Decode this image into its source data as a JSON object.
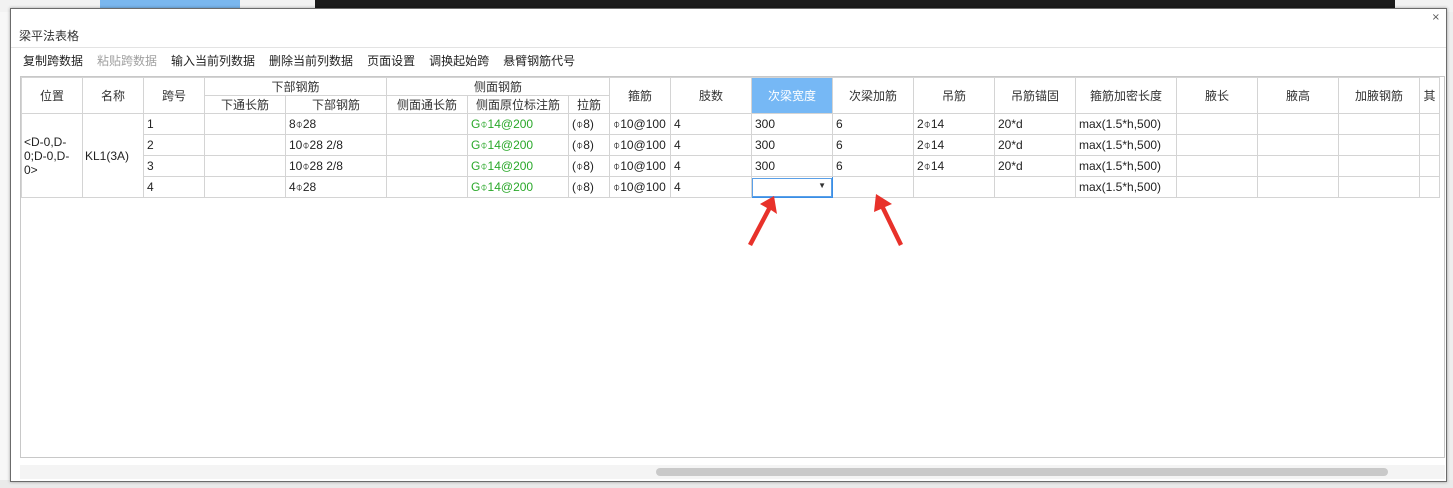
{
  "dialog": {
    "title": "梁平法表格",
    "close_label": "×"
  },
  "toolbar": [
    {
      "label": "复制跨数据",
      "enabled": true
    },
    {
      "label": "粘贴跨数据",
      "enabled": false
    },
    {
      "label": "输入当前列数据",
      "enabled": true
    },
    {
      "label": "删除当前列数据",
      "enabled": true
    },
    {
      "label": "页面设置",
      "enabled": true
    },
    {
      "label": "调换起始跨",
      "enabled": true
    },
    {
      "label": "悬臂钢筋代号",
      "enabled": true
    }
  ],
  "table": {
    "group_headers": {
      "bottom_rebar": "下部钢筋",
      "side_rebar": "侧面钢筋"
    },
    "headers": {
      "position": "位置",
      "name": "名称",
      "span": "跨号",
      "bottom_through": "下通长筋",
      "bottom_steel": "下部钢筋",
      "side_through": "侧面通长筋",
      "side_original": "侧面原位标注筋",
      "tie": "拉筋",
      "stirrup": "箍筋",
      "legs": "肢数",
      "sec_beam_width": "次梁宽度",
      "sec_beam_add": "次梁加筋",
      "hanger": "吊筋",
      "hanger_anchor": "吊筋锚固",
      "stirrup_dense": "箍筋加密长度",
      "haunch_len": "腋长",
      "haunch_height": "腋高",
      "haunch_steel": "加腋钢筋",
      "other": "其"
    },
    "merged": {
      "position": "<D-0,D-0;D-0,D-0>",
      "name": "KL1(3A)"
    },
    "rows": [
      {
        "span": "1",
        "bottom_through": "",
        "bottom_steel": "8⌽28",
        "side_through": "",
        "side_original": "G⌽14@200",
        "tie": "(⌽8)",
        "stirrup": "⌽10@100",
        "legs": "4",
        "sec_beam_width": "300",
        "sec_beam_add": "6",
        "hanger": "2⌽14",
        "hanger_anchor": "20*d",
        "stirrup_dense": "max(1.5*h,500)",
        "haunch_len": "",
        "haunch_height": "",
        "haunch_steel": "",
        "other": ""
      },
      {
        "span": "2",
        "bottom_through": "",
        "bottom_steel": "10⌽28 2/8",
        "side_through": "",
        "side_original": "G⌽14@200",
        "tie": "(⌽8)",
        "stirrup": "⌽10@100",
        "legs": "4",
        "sec_beam_width": "300",
        "sec_beam_add": "6",
        "hanger": "2⌽14",
        "hanger_anchor": "20*d",
        "stirrup_dense": "max(1.5*h,500)",
        "haunch_len": "",
        "haunch_height": "",
        "haunch_steel": "",
        "other": ""
      },
      {
        "span": "3",
        "bottom_through": "",
        "bottom_steel": "10⌽28 2/8",
        "side_through": "",
        "side_original": "G⌽14@200",
        "tie": "(⌽8)",
        "stirrup": "⌽10@100",
        "legs": "4",
        "sec_beam_width": "300",
        "sec_beam_add": "6",
        "hanger": "2⌽14",
        "hanger_anchor": "20*d",
        "stirrup_dense": "max(1.5*h,500)",
        "haunch_len": "",
        "haunch_height": "",
        "haunch_steel": "",
        "other": ""
      },
      {
        "span": "4",
        "bottom_through": "",
        "bottom_steel": "4⌽28",
        "side_through": "",
        "side_original": "G⌽14@200",
        "tie": "(⌽8)",
        "stirrup": "⌽10@100",
        "legs": "4",
        "sec_beam_width": "",
        "sec_beam_add": "",
        "hanger": "",
        "hanger_anchor": "",
        "stirrup_dense": "max(1.5*h,500)",
        "haunch_len": "",
        "haunch_height": "",
        "haunch_steel": "",
        "other": ""
      }
    ],
    "selected_column": "sec_beam_width"
  },
  "colors": {
    "selected_header": "#76b8f5",
    "green_text": "#2aa82a",
    "annotation_arrow": "#e8312a"
  },
  "icons": {
    "dropdown": "chevron-down-icon",
    "annotation": "red-arrow-icon"
  }
}
